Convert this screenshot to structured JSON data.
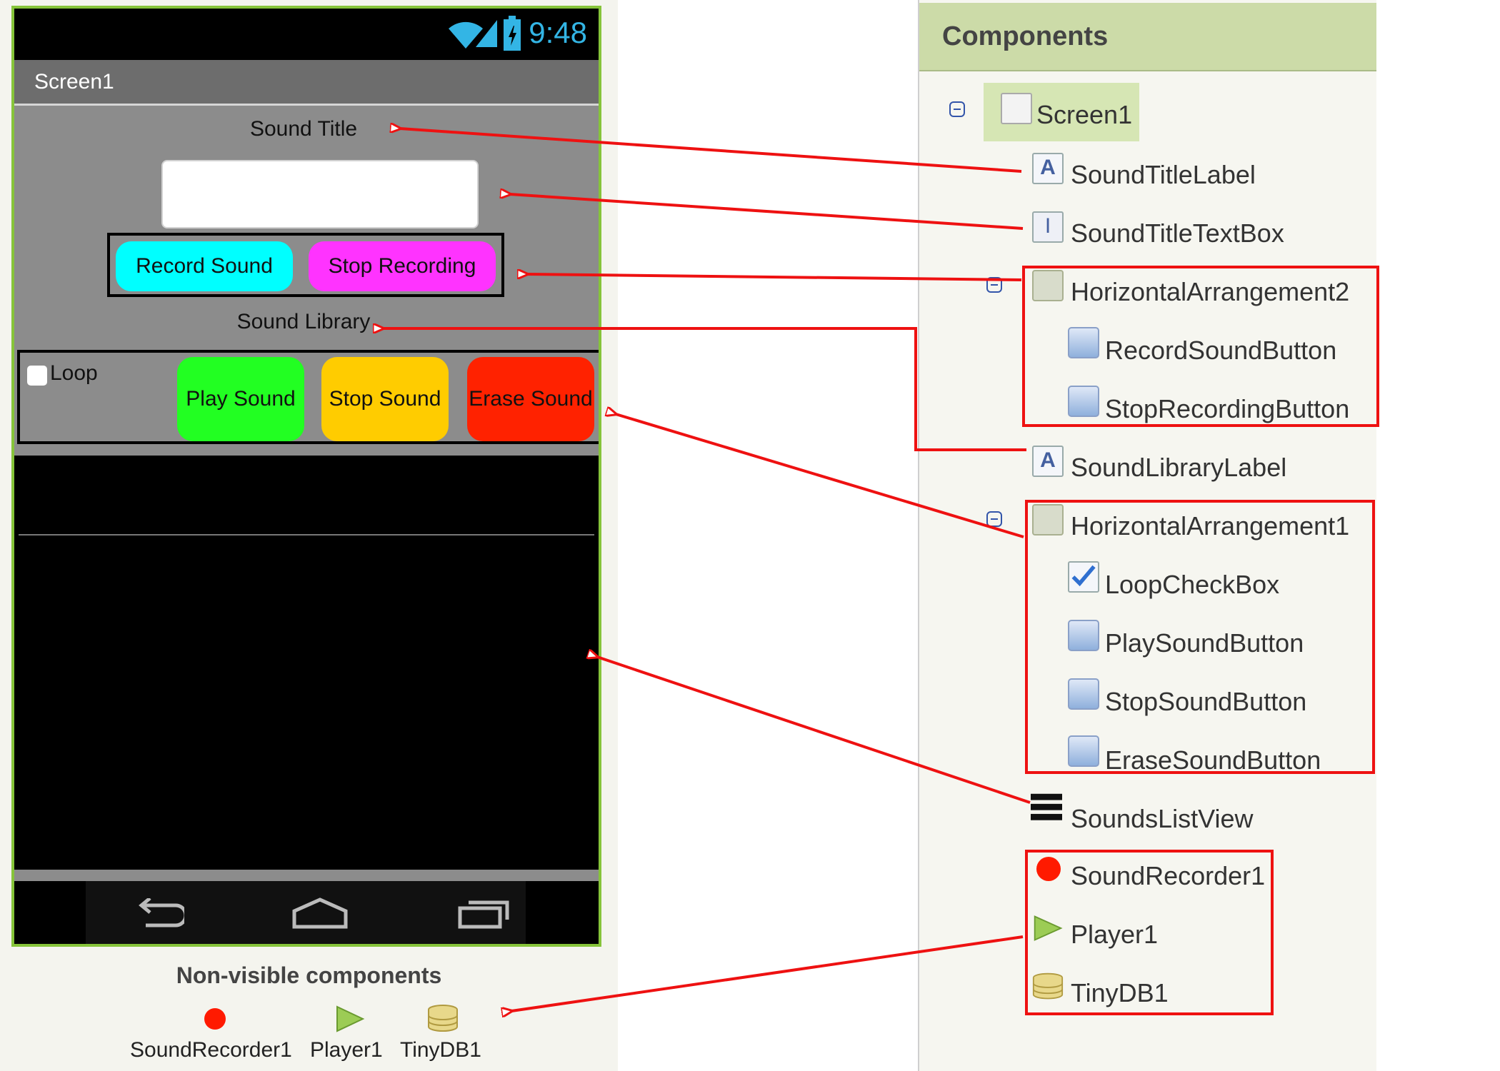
{
  "phone": {
    "time": "9:48",
    "screen_title": "Screen1",
    "sound_title_label": "Sound Title",
    "record_button": "Record Sound",
    "stop_recording_button": "Stop Recording",
    "sound_library_label": "Sound Library",
    "loop_label": "Loop",
    "play_button": "Play Sound",
    "stop_button": "Stop Sound",
    "erase_button": "Erase Sound",
    "colors": {
      "record": "#00ffff",
      "stop_recording": "#ff33ff",
      "play": "#22ff22",
      "stop": "#ffcc00",
      "erase": "#ff2200",
      "border": "#86c43a"
    }
  },
  "nonvisible": {
    "heading": "Non-visible components",
    "items": [
      {
        "label": "SoundRecorder1",
        "icon": "red-dot-icon"
      },
      {
        "label": "Player1",
        "icon": "play-triangle-icon"
      },
      {
        "label": "TinyDB1",
        "icon": "database-icon"
      }
    ]
  },
  "components": {
    "header": "Components",
    "tree": [
      {
        "label": "Screen1",
        "icon": "screen-icon"
      },
      {
        "label": "SoundTitleLabel",
        "icon": "label-icon"
      },
      {
        "label": "SoundTitleTextBox",
        "icon": "textbox-icon"
      },
      {
        "label": "HorizontalArrangement2",
        "icon": "arrangement-icon"
      },
      {
        "label": "RecordSoundButton",
        "icon": "button-icon"
      },
      {
        "label": "StopRecordingButton",
        "icon": "button-icon"
      },
      {
        "label": "SoundLibraryLabel",
        "icon": "label-icon"
      },
      {
        "label": "HorizontalArrangement1",
        "icon": "arrangement-icon"
      },
      {
        "label": "LoopCheckBox",
        "icon": "checkbox-icon"
      },
      {
        "label": "PlaySoundButton",
        "icon": "button-icon"
      },
      {
        "label": "StopSoundButton",
        "icon": "button-icon"
      },
      {
        "label": "EraseSoundButton",
        "icon": "button-icon"
      },
      {
        "label": "SoundsListView",
        "icon": "listview-icon"
      },
      {
        "label": "SoundRecorder1",
        "icon": "red-dot-icon"
      },
      {
        "label": "Player1",
        "icon": "play-triangle-icon"
      },
      {
        "label": "TinyDB1",
        "icon": "database-icon"
      }
    ]
  },
  "annotation_color": "#ee1111"
}
